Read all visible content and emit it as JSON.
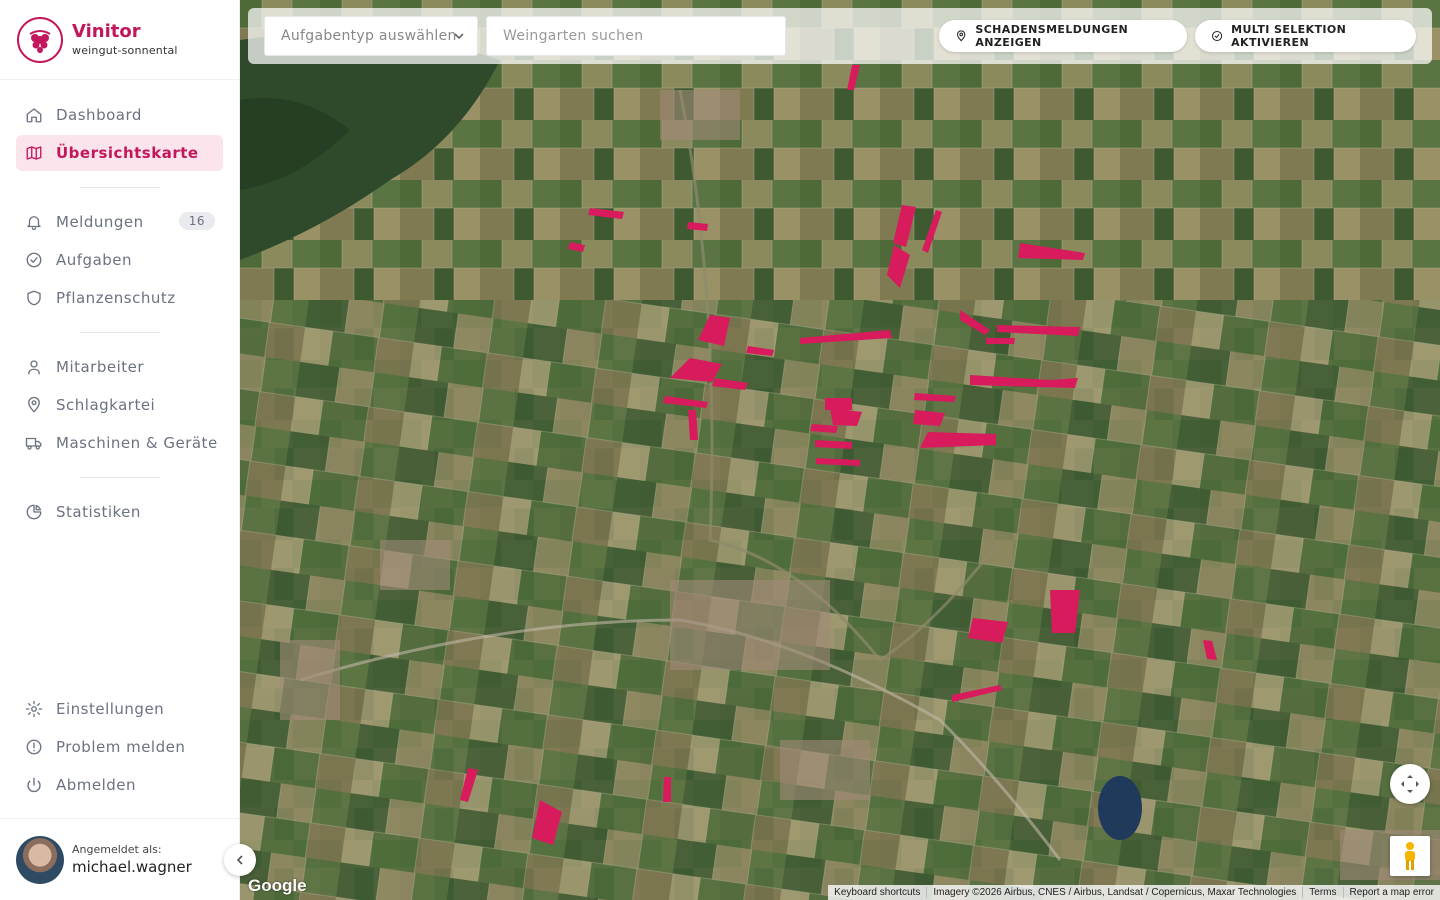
{
  "brand": {
    "name": "Vinitor",
    "subtitle": "weingut-sonnental",
    "color": "#c2185b"
  },
  "nav": {
    "dashboard": "Dashboard",
    "map": "Übersichtskarte",
    "meldungen": "Meldungen",
    "meldungen_count": "16",
    "aufgaben": "Aufgaben",
    "pflanzenschutz": "Pflanzenschutz",
    "mitarbeiter": "Mitarbeiter",
    "schlagkartei": "Schlagkartei",
    "maschinen": "Maschinen & Geräte",
    "statistiken": "Statistiken",
    "einstellungen": "Einstellungen",
    "problem": "Problem melden",
    "abmelden": "Abmelden"
  },
  "user": {
    "label": "Angemeldet als:",
    "name": "michael.wagner"
  },
  "toolbar": {
    "task_type_placeholder": "Aufgabentyp auswählen",
    "vineyard_search_placeholder": "Weingarten suchen",
    "damage_button": "SCHADENSMELDUNGEN ANZEIGEN",
    "multi_button": "MULTI SELEKTION AKTIVIEREN"
  },
  "map": {
    "logo": "Google",
    "attribution": {
      "shortcuts": "Keyboard shortcuts",
      "imagery": "Imagery ©2026 Airbus, CNES / Airbus, Landsat / Copernicus, Maxar Technologies",
      "terms": "Terms",
      "report": "Report a map error"
    }
  }
}
